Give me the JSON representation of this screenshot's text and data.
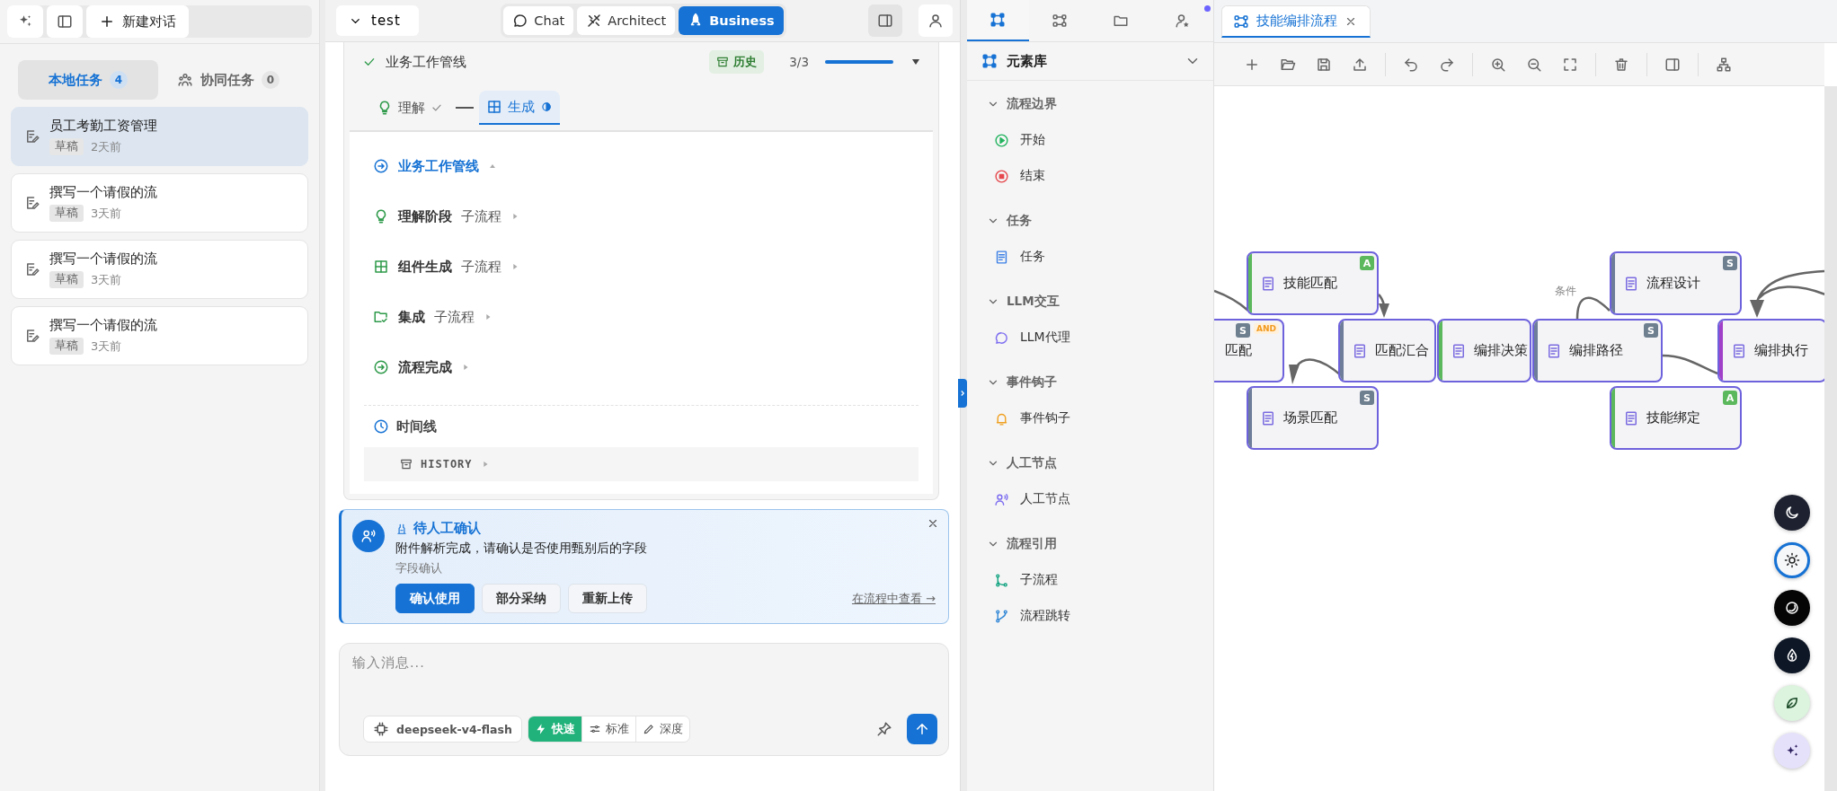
{
  "left_panel": {
    "new_chat": "新建对话",
    "tabs": [
      {
        "label": "本地任务",
        "count": "4",
        "kind": "local",
        "selected": true
      },
      {
        "label": "协同任务",
        "count": "0",
        "kind": "team",
        "selected": false
      }
    ],
    "tasks": [
      {
        "title": "员工考勤工资管理",
        "status": "草稿",
        "time": "2天前",
        "selected": true
      },
      {
        "title": "撰写一个请假的流",
        "status": "草稿",
        "time": "3天前",
        "selected": false
      },
      {
        "title": "撰写一个请假的流",
        "status": "草稿",
        "time": "3天前",
        "selected": false
      },
      {
        "title": "撰写一个请假的流",
        "status": "草稿",
        "time": "3天前",
        "selected": false
      }
    ]
  },
  "header": {
    "project": "test",
    "modes": [
      {
        "label": "Chat",
        "kind": "chat",
        "selected": false
      },
      {
        "label": "Architect",
        "kind": "architect",
        "selected": false
      },
      {
        "label": "Business",
        "kind": "business",
        "selected": true
      }
    ]
  },
  "pipeline": {
    "title": "业务工作管线",
    "done": true,
    "badge": "历史",
    "progress": "3/3",
    "level": 1,
    "expanded": true,
    "steps": [
      {
        "label": "理解",
        "kind": "understand",
        "done": true,
        "selected": false
      },
      {
        "label": "生成",
        "kind": "generate",
        "done": false,
        "selected": true
      }
    ],
    "tree": {
      "label": "业务工作管线",
      "kind": "pipeline",
      "expanded": true,
      "children": [
        {
          "label": "理解阶段",
          "tag": "子流程",
          "kind": "understand",
          "expanded": false
        },
        {
          "label": "组件生成",
          "tag": "子流程",
          "kind": "generate",
          "expanded": false
        },
        {
          "label": "集成",
          "tag": "子流程",
          "kind": "integrate",
          "expanded": false
        },
        {
          "label": "流程完成",
          "kind": "complete",
          "expanded": false
        }
      ]
    },
    "timeline": {
      "title": "时间线",
      "history": "HISTORY",
      "expanded": false
    }
  },
  "alert": {
    "title": "待人工确认",
    "message": "附件解析完成，请确认是否使用甄别后的字段",
    "subtitle": "字段确认",
    "buttons": [
      {
        "label": "确认使用",
        "primary": true
      },
      {
        "label": "部分采纳",
        "primary": false
      },
      {
        "label": "重新上传",
        "primary": false
      }
    ],
    "link": "在流程中查看 →"
  },
  "composer": {
    "placeholder": "输入消息...",
    "model": "deepseek-v4-flash",
    "modes": [
      {
        "label": "快速",
        "kind": "fast",
        "selected": true
      },
      {
        "label": "标准",
        "kind": "standard",
        "selected": false
      },
      {
        "label": "深度",
        "kind": "deep",
        "selected": false
      }
    ]
  },
  "palette": {
    "tabs": [
      {
        "kind": "elements",
        "selected": true,
        "notification": false
      },
      {
        "kind": "flow",
        "selected": false,
        "notification": false
      },
      {
        "kind": "folder",
        "selected": false,
        "notification": false
      },
      {
        "kind": "agents",
        "selected": false,
        "notification": true
      }
    ],
    "title": "元素库",
    "groups": [
      {
        "label": "流程边界",
        "expanded": true,
        "items": [
          {
            "label": "开始",
            "kind": "start"
          },
          {
            "label": "结束",
            "kind": "end"
          }
        ]
      },
      {
        "label": "任务",
        "expanded": true,
        "items": [
          {
            "label": "任务",
            "kind": "task"
          }
        ]
      },
      {
        "label": "LLM交互",
        "expanded": true,
        "items": [
          {
            "label": "LLM代理",
            "kind": "llm"
          }
        ]
      },
      {
        "label": "事件钩子",
        "expanded": true,
        "items": [
          {
            "label": "事件钩子",
            "kind": "hook"
          }
        ]
      },
      {
        "label": "人工节点",
        "expanded": true,
        "items": [
          {
            "label": "人工节点",
            "kind": "human"
          }
        ]
      },
      {
        "label": "流程引用",
        "expanded": true,
        "items": [
          {
            "label": "子流程",
            "kind": "subflow"
          },
          {
            "label": "流程跳转",
            "kind": "jump"
          }
        ]
      }
    ]
  },
  "editor": {
    "tab": "技能编排流程",
    "edge_label": "条件",
    "nodes": [
      {
        "label": "技能匹配",
        "color": "#5cb85c",
        "badge": {
          "label": "A",
          "color": "#5cb85c"
        }
      },
      {
        "label": "流程设计",
        "color": "#6e7d99",
        "badge": {
          "label": "S",
          "color": "#6e7f8f"
        }
      },
      {
        "label": "匹配",
        "partial": true,
        "badge": {
          "label": "S",
          "color": "#6e7f8f"
        },
        "gate": "AND"
      },
      {
        "label": "匹配汇合",
        "color": "#6e7d99"
      },
      {
        "label": "编排决策",
        "color": "#5cb85c"
      },
      {
        "label": "编排路径",
        "color": "#6e7d99",
        "badge": {
          "label": "S",
          "color": "#6e7f8f"
        }
      },
      {
        "label": "编排执行",
        "color": "#a040c8"
      },
      {
        "label": "场景匹配",
        "color": "#6e7d99",
        "badge": {
          "label": "S",
          "color": "#6e7f8f"
        }
      },
      {
        "label": "技能绑定",
        "color": "#5cb85c",
        "badge": {
          "label": "A",
          "color": "#5cb85c"
        }
      }
    ]
  },
  "themes": [
    {
      "kind": "dark",
      "selected": false
    },
    {
      "kind": "light",
      "selected": true
    },
    {
      "kind": "contrast",
      "selected": false
    },
    {
      "kind": "ocean",
      "selected": false
    },
    {
      "kind": "nature",
      "selected": false
    },
    {
      "kind": "violet",
      "selected": false
    }
  ]
}
